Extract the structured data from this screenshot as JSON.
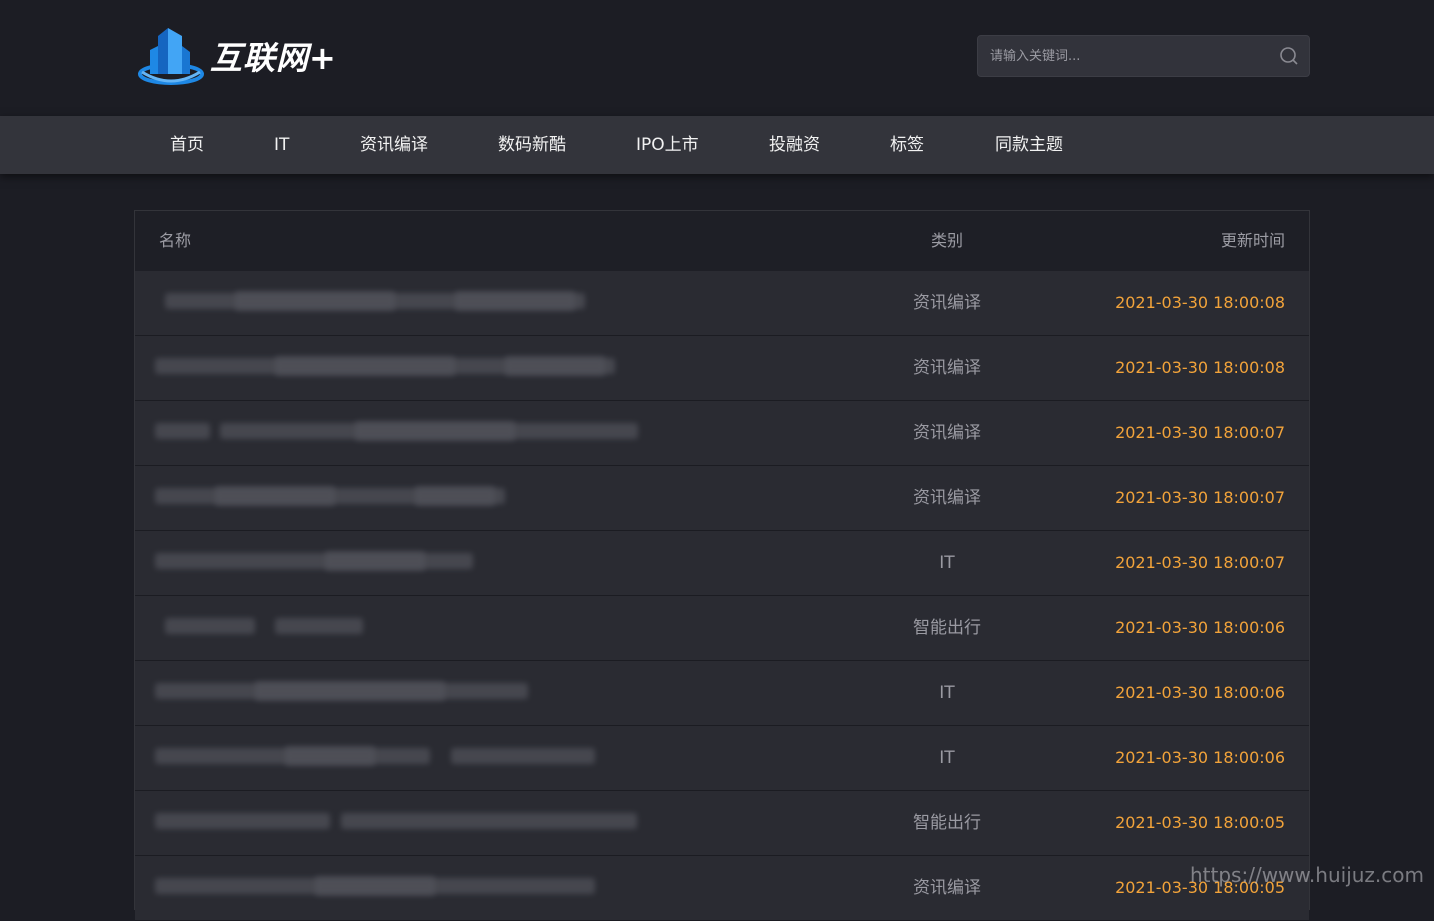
{
  "brand": {
    "name": "互联网+"
  },
  "search": {
    "placeholder": "请输入关键词..."
  },
  "nav": [
    "首页",
    "IT",
    "资讯编译",
    "数码新酷",
    "IPO上市",
    "投融资",
    "标签",
    "同款主题"
  ],
  "table": {
    "headers": {
      "name": "名称",
      "category": "类别",
      "time": "更新时间"
    },
    "rows": [
      {
        "category": "资讯编译",
        "time": "2021-03-30 18:00:08"
      },
      {
        "category": "资讯编译",
        "time": "2021-03-30 18:00:08"
      },
      {
        "category": "资讯编译",
        "time": "2021-03-30 18:00:07"
      },
      {
        "category": "资讯编译",
        "time": "2021-03-30 18:00:07"
      },
      {
        "category": "IT",
        "time": "2021-03-30 18:00:07"
      },
      {
        "category": "智能出行",
        "time": "2021-03-30 18:00:06"
      },
      {
        "category": "IT",
        "time": "2021-03-30 18:00:06"
      },
      {
        "category": "IT",
        "time": "2021-03-30 18:00:06"
      },
      {
        "category": "智能出行",
        "time": "2021-03-30 18:00:05"
      },
      {
        "category": "资讯编译",
        "time": "2021-03-30 18:00:05"
      }
    ]
  },
  "watermark": "https://www.huijuz.com",
  "colors": {
    "accent": "#f2a33a",
    "background": "#1c1d24",
    "nav": "#33343b"
  }
}
